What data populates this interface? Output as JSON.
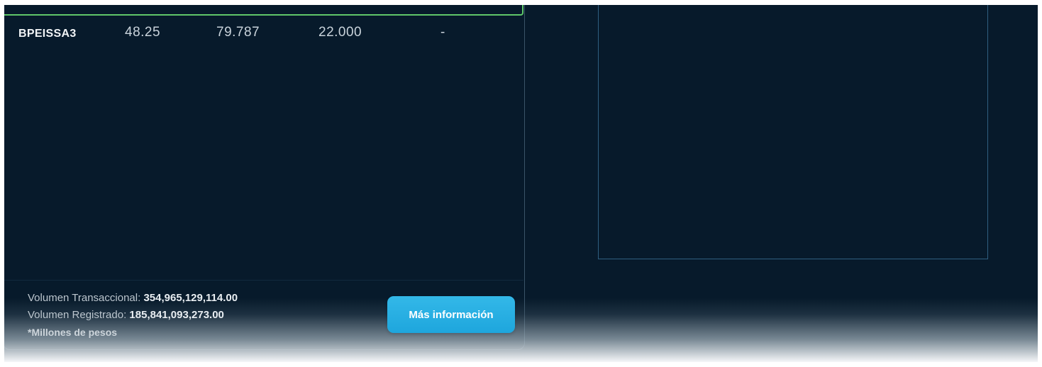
{
  "table": {
    "rows": [
      {
        "symbol": "BPEISSA3",
        "col1": "48.25",
        "col2": "79.787",
        "col3": "22.000",
        "col4": "-"
      }
    ]
  },
  "footer": {
    "transactional_label": "Volumen Transaccional: ",
    "transactional_value": "354,965,129,114.00",
    "registered_label": "Volumen Registrado: ",
    "registered_value": "185,841,093,273.00",
    "note": "*Millones de pesos",
    "more_info_button": "Más información"
  },
  "colors": {
    "background": "#071a2b",
    "accent_green": "#5fc76a",
    "button_blue": "#1ea6dd",
    "frame_blue": "#2f5f80"
  }
}
